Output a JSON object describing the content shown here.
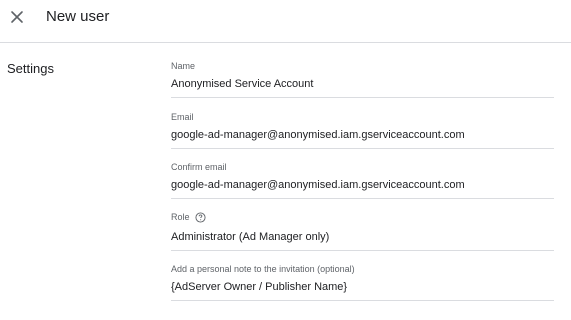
{
  "header": {
    "title": "New user",
    "close_icon": "close-icon"
  },
  "settings": {
    "section_label": "Settings",
    "fields": {
      "name": {
        "label": "Name",
        "value": "Anonymised Service Account"
      },
      "email": {
        "label": "Email",
        "value": "google-ad-manager@anonymised.iam.gserviceaccount.com"
      },
      "confirm_email": {
        "label": "Confirm email",
        "value": "google-ad-manager@anonymised.iam.gserviceaccount.com"
      },
      "role": {
        "label": "Role",
        "value": "Administrator (Ad Manager only)",
        "help_icon": "help-icon"
      },
      "note": {
        "label": "Add a personal note to the invitation (optional)",
        "value": "{AdServer Owner / Publisher Name}"
      }
    }
  }
}
